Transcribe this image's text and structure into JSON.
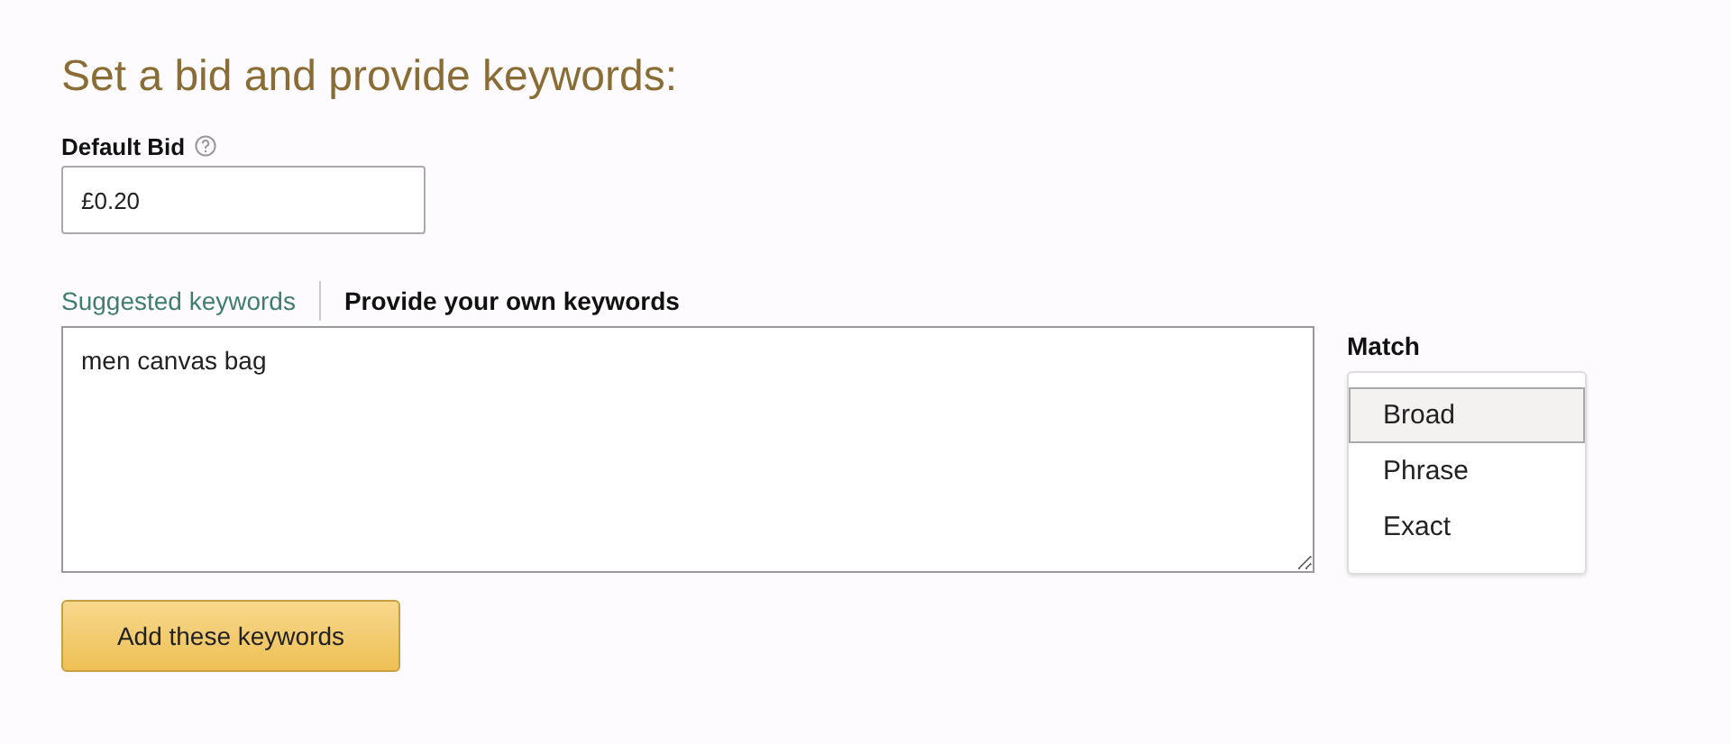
{
  "heading": "Set a bid and provide keywords:",
  "default_bid": {
    "label": "Default Bid",
    "value": "£0.20"
  },
  "tabs": [
    {
      "label": "Suggested keywords",
      "selected": false
    },
    {
      "label": "Provide your own keywords",
      "selected": true
    }
  ],
  "keywords": {
    "value": "men canvas bag"
  },
  "match": {
    "label": "Match",
    "options": [
      {
        "label": "Broad",
        "selected": true
      },
      {
        "label": "Phrase",
        "selected": false
      },
      {
        "label": "Exact",
        "selected": false
      }
    ]
  },
  "button": "Add these keywords"
}
